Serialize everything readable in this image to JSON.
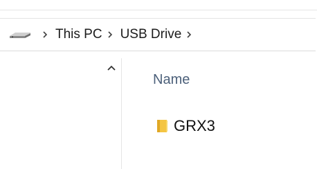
{
  "breadcrumb": {
    "items": [
      {
        "label": "This PC"
      },
      {
        "label": "USB Drive"
      }
    ]
  },
  "file_list": {
    "column_name_label": "Name",
    "items": [
      {
        "name": "GRX3",
        "type": "folder"
      }
    ]
  },
  "icons": {
    "drive": "usb-drive-icon",
    "separator": "chevron-right-icon",
    "collapse": "chevron-up-icon",
    "folder": "folder-icon"
  },
  "colors": {
    "column_header": "#4c607a",
    "folder": "#f4c542",
    "separator": "#404040"
  }
}
